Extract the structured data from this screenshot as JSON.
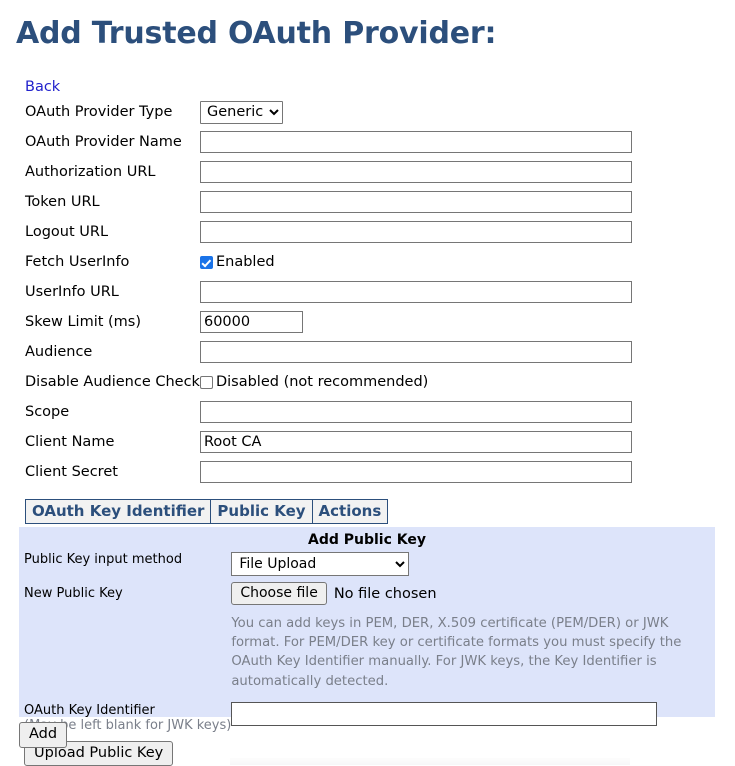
{
  "page": {
    "title": "Add Trusted OAuth Provider:",
    "back_link": "Back",
    "title_color": "#2c4f7c",
    "link_color": "#2222cc"
  },
  "form": {
    "rows": [
      {
        "label": "OAuth Provider Type",
        "control": "select",
        "value": "Generic"
      },
      {
        "label": "OAuth Provider Name",
        "control": "text",
        "value": ""
      },
      {
        "label": "Authorization URL",
        "control": "text",
        "value": ""
      },
      {
        "label": "Token URL",
        "control": "text",
        "value": ""
      },
      {
        "label": "Logout URL",
        "control": "text",
        "value": ""
      },
      {
        "label": "Fetch UserInfo",
        "control": "checkbox",
        "checkbox_label": "Enabled",
        "checked": true
      },
      {
        "label": "UserInfo URL",
        "control": "text",
        "value": ""
      },
      {
        "label": "Skew Limit (ms)",
        "control": "text-small",
        "value": "60000"
      },
      {
        "label": "Audience",
        "control": "text",
        "value": ""
      },
      {
        "label": "Disable Audience Check",
        "control": "checkbox",
        "checkbox_label": "Disabled (not recommended)",
        "checked": false
      },
      {
        "label": "Scope",
        "control": "text",
        "value": ""
      },
      {
        "label": "Client Name",
        "control": "text",
        "value": "Root CA"
      },
      {
        "label": "Client Secret",
        "control": "text",
        "value": ""
      }
    ],
    "provider_type_options": [
      "Generic"
    ]
  },
  "keys_table": {
    "columns": [
      "OAuth Key Identifier",
      "Public Key",
      "Actions"
    ],
    "rows": [],
    "header_color": "#2c4f7c",
    "header_bg": "#f2f2f2"
  },
  "add_public_key": {
    "panel_title": "Add Public Key",
    "panel_bg": "#dde4fa",
    "input_method_label": "Public Key input method",
    "input_method_value": "File Upload",
    "input_method_options": [
      "File Upload"
    ],
    "new_public_key_label": "New Public Key",
    "choose_file_button": "Choose file",
    "file_status": "No file chosen",
    "help_text": "You can add keys in PEM, DER, X.509 certificate (PEM/DER) or JWK format. For PEM/DER key or certificate formats you must specify the OAuth Key Identifier manually. For JWK keys, the Key Identifier is automatically detected.",
    "key_identifier_label": "OAuth Key Identifier",
    "key_identifier_sublabel": "(May be left blank for JWK keys)",
    "key_identifier_value": "",
    "upload_button": "Upload Public Key"
  },
  "actions": {
    "add_button": "Add"
  }
}
